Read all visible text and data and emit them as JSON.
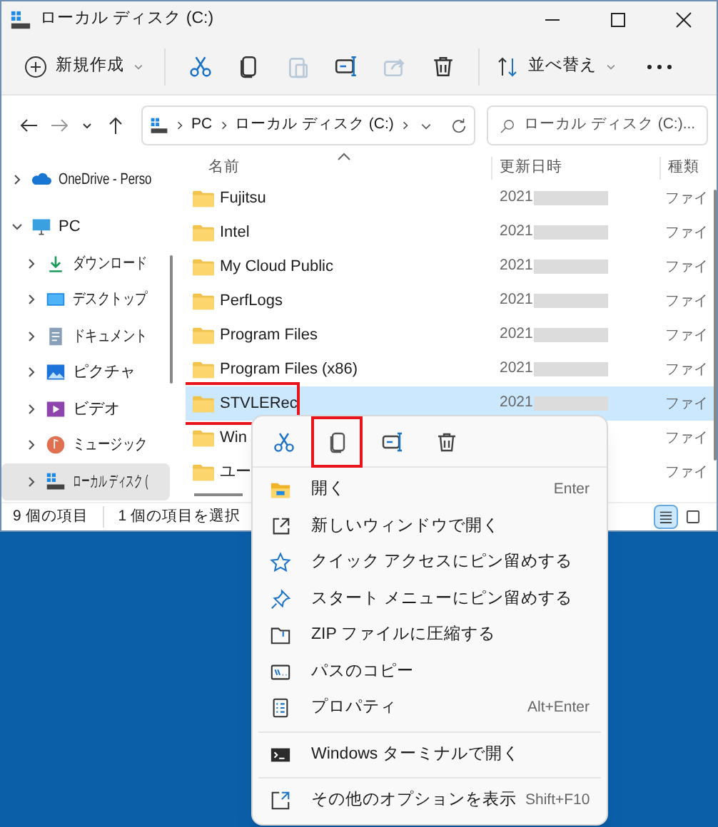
{
  "window": {
    "title": "ローカル ディスク (C:)"
  },
  "toolbar": {
    "new_label": "新規作成",
    "sort_label": "並べ替え",
    "tools": [
      {
        "kind": "cut",
        "disabled": false
      },
      {
        "kind": "copy",
        "disabled": false
      },
      {
        "kind": "paste",
        "disabled": true
      },
      {
        "kind": "rename",
        "disabled": false
      },
      {
        "kind": "share",
        "disabled": true
      },
      {
        "kind": "delete",
        "disabled": false
      }
    ]
  },
  "address_bar": {
    "crumbs": [
      "PC",
      "ローカル ディスク (C:)"
    ]
  },
  "search": {
    "placeholder": "ローカル ディスク (C:)..."
  },
  "navigation": {
    "items": [
      {
        "label": "OneDrive - Perso",
        "kind": "cloud",
        "expanded": false,
        "selected": false
      },
      {
        "label": "PC",
        "kind": "pc",
        "expanded": true,
        "selected": false,
        "children": [
          {
            "label": "ダウンロード",
            "kind": "download",
            "expanded": false,
            "selected": false
          },
          {
            "label": "デスクトップ",
            "kind": "desktop",
            "expanded": false,
            "selected": false
          },
          {
            "label": "ドキュメント",
            "kind": "document",
            "expanded": false,
            "selected": false
          },
          {
            "label": "ピクチャ",
            "kind": "picture",
            "expanded": false,
            "selected": false
          },
          {
            "label": "ビデオ",
            "kind": "video",
            "expanded": false,
            "selected": false
          },
          {
            "label": "ミュージック",
            "kind": "music",
            "expanded": false,
            "selected": false
          },
          {
            "label": "ローカル ディスク (",
            "kind": "drive",
            "expanded": false,
            "selected": true
          }
        ]
      }
    ]
  },
  "file_list": {
    "columns": [
      "名前",
      "更新日時",
      "種類"
    ],
    "rows": [
      {
        "name": "Fujitsu",
        "modified": "2021",
        "type": "ファイ",
        "selected": false,
        "highlighted": false
      },
      {
        "name": "Intel",
        "modified": "2021",
        "type": "ファイ",
        "selected": false,
        "highlighted": false
      },
      {
        "name": "My Cloud Public",
        "modified": "2021",
        "type": "ファイ",
        "selected": false,
        "highlighted": false
      },
      {
        "name": "PerfLogs",
        "modified": "2021",
        "type": "ファイ",
        "selected": false,
        "highlighted": false
      },
      {
        "name": "Program Files",
        "modified": "2021",
        "type": "ファイ",
        "selected": false,
        "highlighted": false
      },
      {
        "name": "Program Files (x86)",
        "modified": "2021",
        "type": "ファイ",
        "selected": false,
        "highlighted": false
      },
      {
        "name": "STVLERec",
        "modified": "2021",
        "type": "ファイ",
        "selected": true,
        "highlighted": true
      },
      {
        "name": "Win",
        "type": "ファイ",
        "selected": false,
        "highlighted": false
      },
      {
        "name": "ユー",
        "type": "ファイ",
        "selected": false,
        "highlighted": false
      }
    ]
  },
  "status_bar": {
    "item_count": "9 個の項目",
    "selection": "1 個の項目を選択",
    "views": [
      {
        "kind": "details",
        "selected": true
      },
      {
        "kind": "tiles",
        "selected": false
      }
    ]
  },
  "context_menu": {
    "actions": [
      {
        "kind": "cut",
        "highlighted": false
      },
      {
        "kind": "copy",
        "highlighted": true
      },
      {
        "kind": "rename",
        "highlighted": false
      },
      {
        "kind": "delete",
        "highlighted": false
      }
    ],
    "items": [
      {
        "kind": "open",
        "label": "開く",
        "shortcut": "Enter",
        "divider_after": false
      },
      {
        "kind": "new-window",
        "label": "新しいウィンドウで開く",
        "divider_after": false
      },
      {
        "kind": "star",
        "label": "クイック アクセスにピン留めする",
        "divider_after": false
      },
      {
        "kind": "pin",
        "label": "スタート メニューにピン留めする",
        "divider_after": false
      },
      {
        "kind": "zip",
        "label": "ZIP ファイルに圧縮する",
        "divider_after": false
      },
      {
        "kind": "path",
        "label": "パスのコピー",
        "divider_after": false
      },
      {
        "kind": "properties",
        "label": "プロパティ",
        "shortcut": "Alt+Enter",
        "divider_after": true
      },
      {
        "kind": "terminal",
        "label": "Windows ターミナルで開く",
        "divider_after": true
      },
      {
        "kind": "more",
        "label": "その他のオプションを表示",
        "shortcut": "Shift+F10",
        "divider_after": false
      }
    ]
  }
}
